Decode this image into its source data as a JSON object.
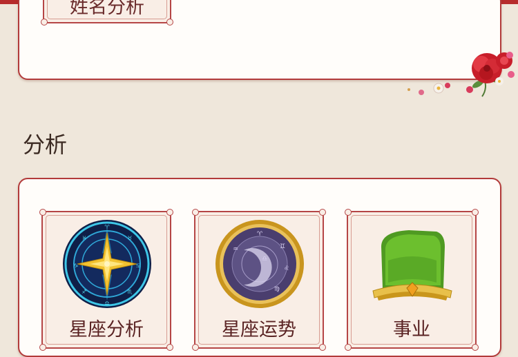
{
  "top_card": {
    "name_analysis_label": "姓名分析"
  },
  "section": {
    "title": "分析"
  },
  "features": [
    {
      "label": "星座分析",
      "icon": "zodiac-compass-icon"
    },
    {
      "label": "星座运势",
      "icon": "zodiac-fortune-dial-icon"
    },
    {
      "label": "事业",
      "icon": "official-hat-icon"
    }
  ],
  "colors": {
    "background": "#efe7db",
    "accent_red": "#b23a3a",
    "tile_bg": "#f9eee6"
  }
}
